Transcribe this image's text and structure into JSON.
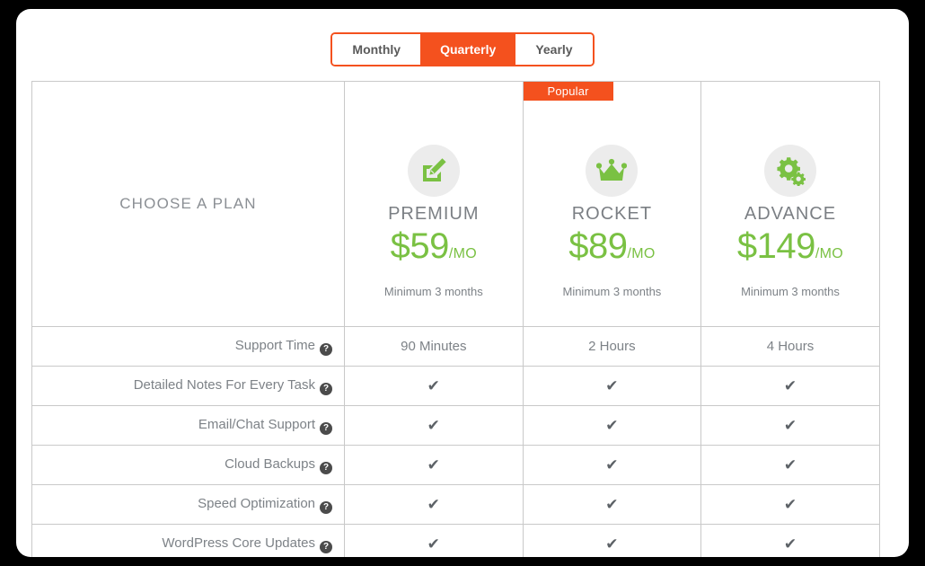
{
  "billing_toggle": {
    "options": [
      {
        "label": "Monthly",
        "active": false
      },
      {
        "label": "Quarterly",
        "active": true
      },
      {
        "label": "Yearly",
        "active": false
      }
    ]
  },
  "table": {
    "corner_label": "CHOOSE A PLAN",
    "plans": [
      {
        "name": "PREMIUM",
        "icon": "edit-pencil-icon",
        "currency": "$",
        "amount": "59",
        "period": "/MO",
        "note": "Minimum 3 months",
        "badge": null
      },
      {
        "name": "ROCKET",
        "icon": "crown-icon",
        "currency": "$",
        "amount": "89",
        "period": "/MO",
        "note": "Minimum 3 months",
        "badge": "Popular"
      },
      {
        "name": "ADVANCE",
        "icon": "gears-icon",
        "currency": "$",
        "amount": "149",
        "period": "/MO",
        "note": "Minimum 3 months",
        "badge": null
      }
    ],
    "features": [
      {
        "label": "Support Time",
        "help": "?",
        "values": [
          "90 Minutes",
          "2 Hours",
          "4 Hours"
        ],
        "type": "text"
      },
      {
        "label": "Detailed Notes For Every Task",
        "help": "?",
        "values": [
          "✔",
          "✔",
          "✔"
        ],
        "type": "check"
      },
      {
        "label": "Email/Chat Support",
        "help": "?",
        "values": [
          "✔",
          "✔",
          "✔"
        ],
        "type": "check"
      },
      {
        "label": "Cloud Backups",
        "help": "?",
        "values": [
          "✔",
          "✔",
          "✔"
        ],
        "type": "check"
      },
      {
        "label": "Speed Optimization",
        "help": "?",
        "values": [
          "✔",
          "✔",
          "✔"
        ],
        "type": "check"
      },
      {
        "label": "WordPress Core Updates",
        "help": "?",
        "values": [
          "✔",
          "✔",
          "✔"
        ],
        "type": "check"
      }
    ]
  },
  "colors": {
    "accent_orange": "#f4511e",
    "price_green": "#7ac143",
    "text_gray": "#7d8287",
    "border_gray": "#c9c9c9",
    "icon_circle_bg": "#ececec",
    "page_bg": "#000000",
    "card_bg": "#ffffff"
  }
}
